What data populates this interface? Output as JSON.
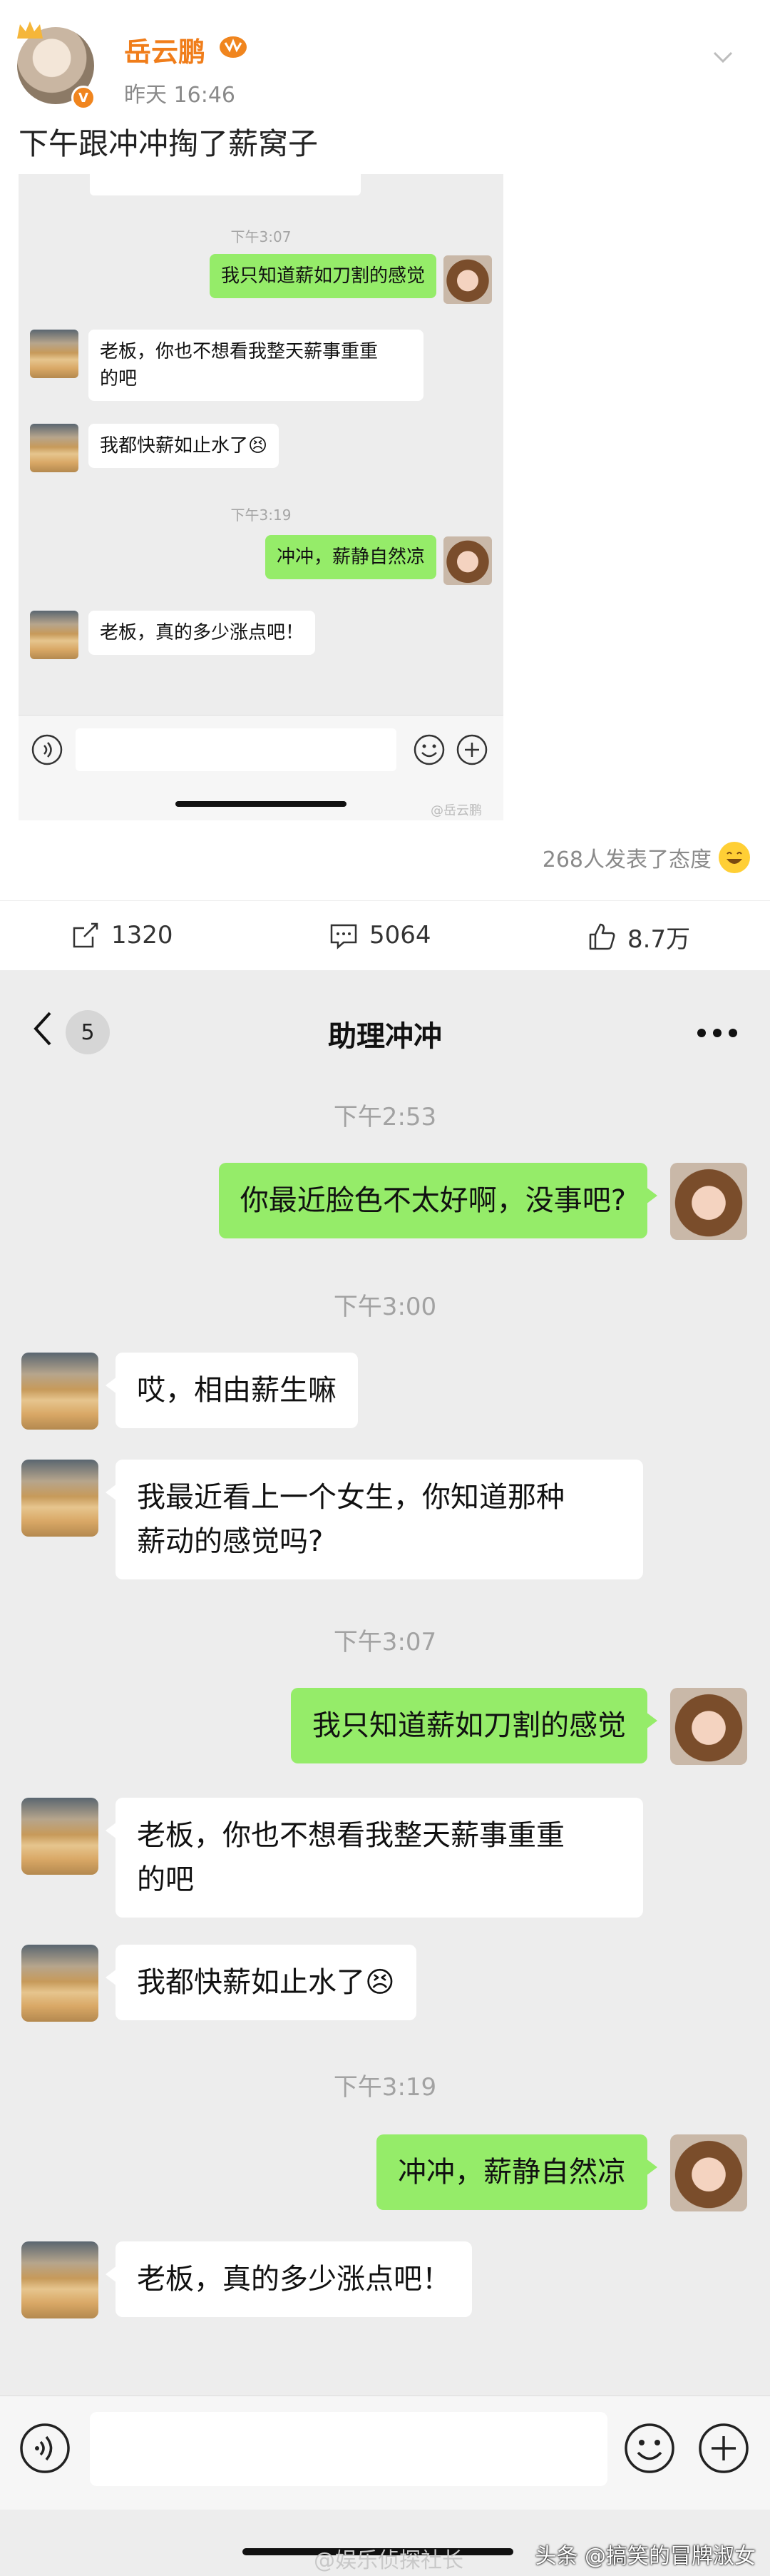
{
  "weibo": {
    "user_name": "岳云鹏",
    "post_time": "昨天 16:46",
    "post_text": "下午跟冲冲掏了薪窝子",
    "embedded_chat": {
      "messages": [
        {
          "type": "time",
          "text": "下午3:07"
        },
        {
          "type": "sent",
          "text": "我只知道薪如刀割的感觉"
        },
        {
          "type": "received",
          "lines": [
            "老板，你也不想看我整天薪事重重",
            "的吧"
          ]
        },
        {
          "type": "received",
          "text": "我都快薪如止水了😣"
        },
        {
          "type": "time",
          "text": "下午3:19"
        },
        {
          "type": "sent",
          "text": "冲冲，薪静自然凉"
        },
        {
          "type": "received",
          "text": "老板，真的多少涨点吧！"
        }
      ],
      "watermark": "@岳云鹏"
    },
    "reactions_text": "268人发表了态度",
    "repost_count": "1320",
    "comment_count": "5064",
    "like_count": "8.7万",
    "colors": {
      "name": "#f07d1a",
      "vbadge": "#f0851e"
    }
  },
  "wechat": {
    "back_badge": "5",
    "title": "助理冲冲",
    "messages": [
      {
        "type": "time",
        "text": "下午2:53"
      },
      {
        "type": "sent",
        "text": "你最近脸色不太好啊，没事吧?"
      },
      {
        "type": "time",
        "text": "下午3:00"
      },
      {
        "type": "received",
        "text": "哎，相由薪生嘛"
      },
      {
        "type": "received",
        "lines": [
          "我最近看上一个女生，你知道那种",
          "薪动的感觉吗?"
        ]
      },
      {
        "type": "time",
        "text": "下午3:07"
      },
      {
        "type": "sent",
        "text": "我只知道薪如刀割的感觉"
      },
      {
        "type": "received",
        "lines": [
          "老板，你也不想看我整天薪事重重",
          "的吧"
        ]
      },
      {
        "type": "received",
        "text": "我都快薪如止水了😣"
      },
      {
        "type": "time",
        "text": "下午3:19"
      },
      {
        "type": "sent",
        "text": "冲冲，薪静自然凉"
      },
      {
        "type": "received",
        "text": "老板，真的多少涨点吧！"
      }
    ],
    "watermark_center": "@娱乐侦探社长",
    "watermark_right": "头条 @搞笑的冒牌淑女",
    "colors": {
      "sent_bubble": "#95ec69",
      "background": "#ededed"
    }
  }
}
